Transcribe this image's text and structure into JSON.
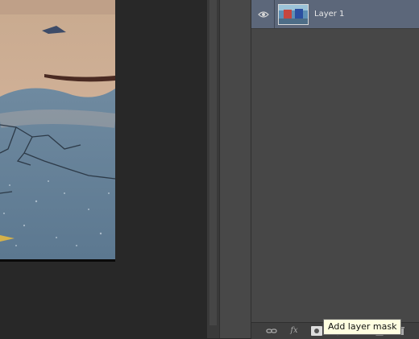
{
  "layers": [
    {
      "name": "Layer 1",
      "visible": true,
      "selected": true
    }
  ],
  "bottom_bar": {
    "icons": [
      "link-icon",
      "fx-icon",
      "add-mask-icon",
      "adjustment-icon",
      "group-icon",
      "new-layer-icon",
      "trash-icon"
    ],
    "fx_label": "fx"
  },
  "tooltip": {
    "text": "Add layer mask"
  },
  "colors": {
    "selected_row": "#5c677a",
    "panel_bg": "#474747",
    "canvas_bg": "#282828",
    "tooltip_bg": "#ffffe1"
  }
}
